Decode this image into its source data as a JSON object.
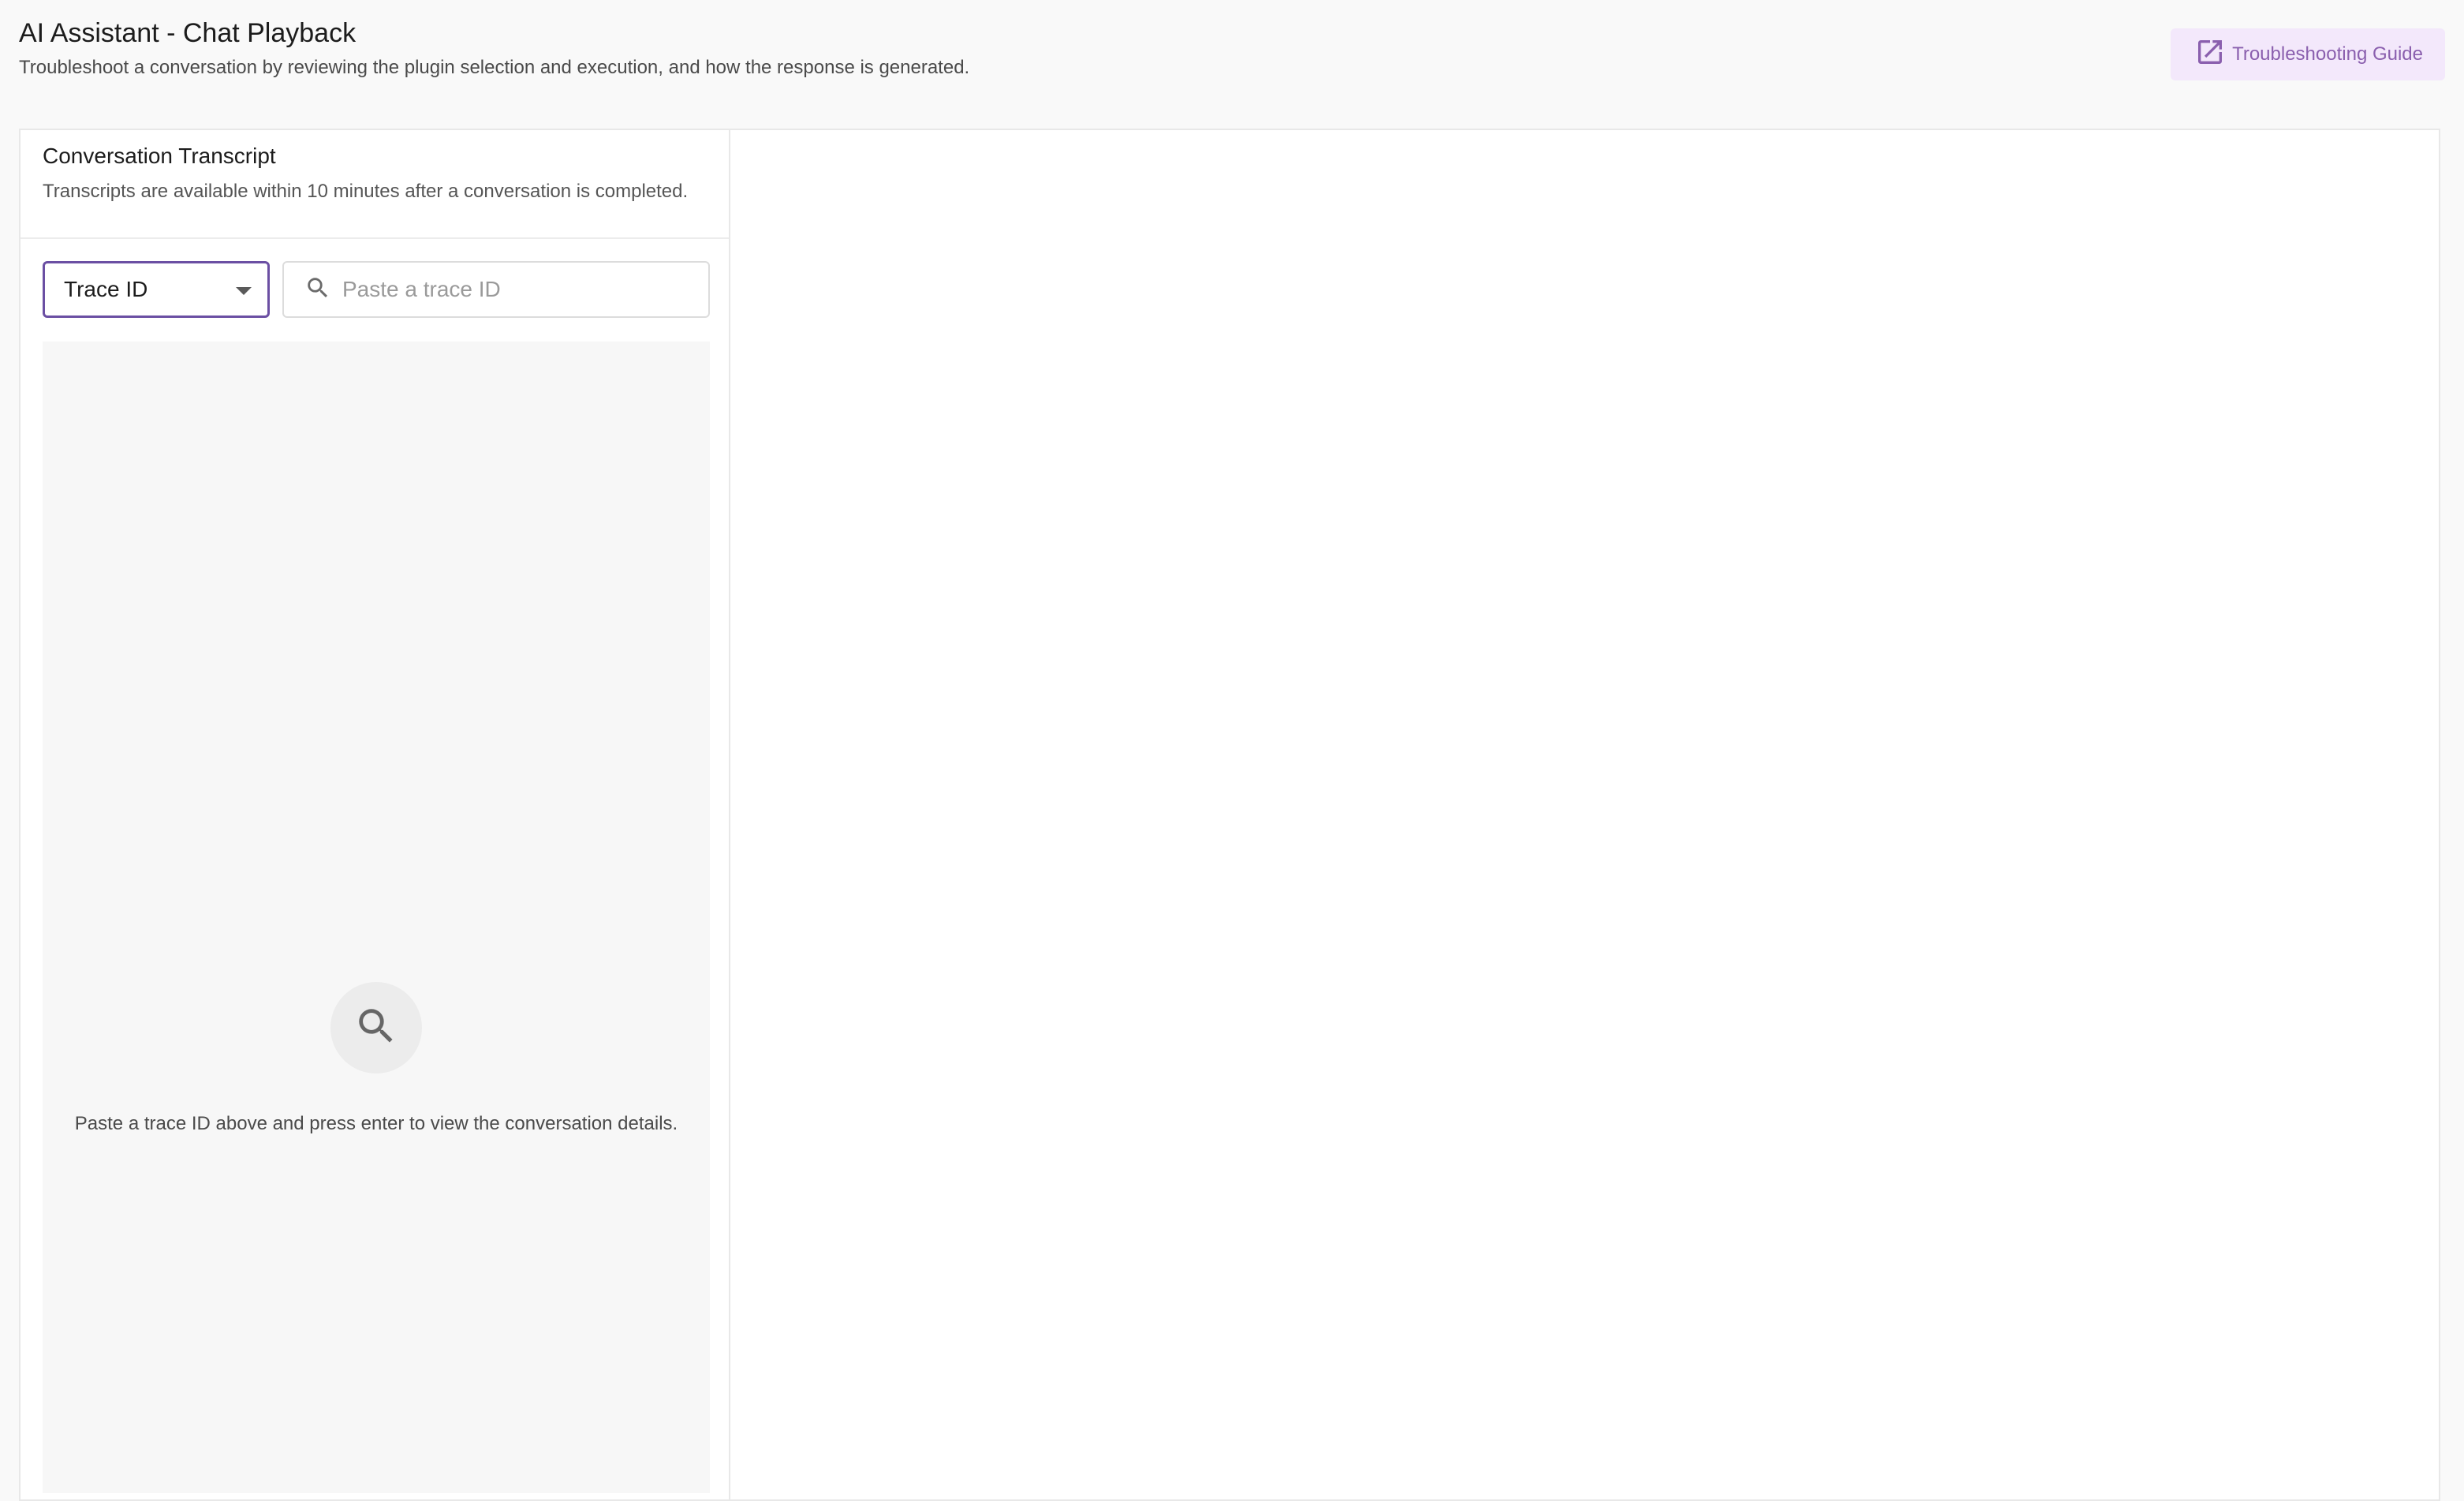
{
  "header": {
    "title": "AI Assistant - Chat Playback",
    "subtitle": "Troubleshoot a conversation by reviewing the plugin selection and execution, and how the response is generated.",
    "guide_button": {
      "label": "Troubleshooting Guide",
      "icon": "open-in-new-icon"
    }
  },
  "transcript": {
    "title": "Conversation Transcript",
    "description": "Transcripts are available within 10 minutes after a conversation is completed.",
    "select": {
      "value": "Trace ID"
    },
    "search": {
      "placeholder": "Paste a trace ID",
      "value": "",
      "icon": "search-icon"
    },
    "empty_state": {
      "icon": "search-icon",
      "message": "Paste a trace ID above and press enter to view the conversation details."
    }
  },
  "colors": {
    "accent": "#6b4fa3",
    "guide_bg": "#f3e8fb",
    "guide_text": "#8a5fae"
  }
}
